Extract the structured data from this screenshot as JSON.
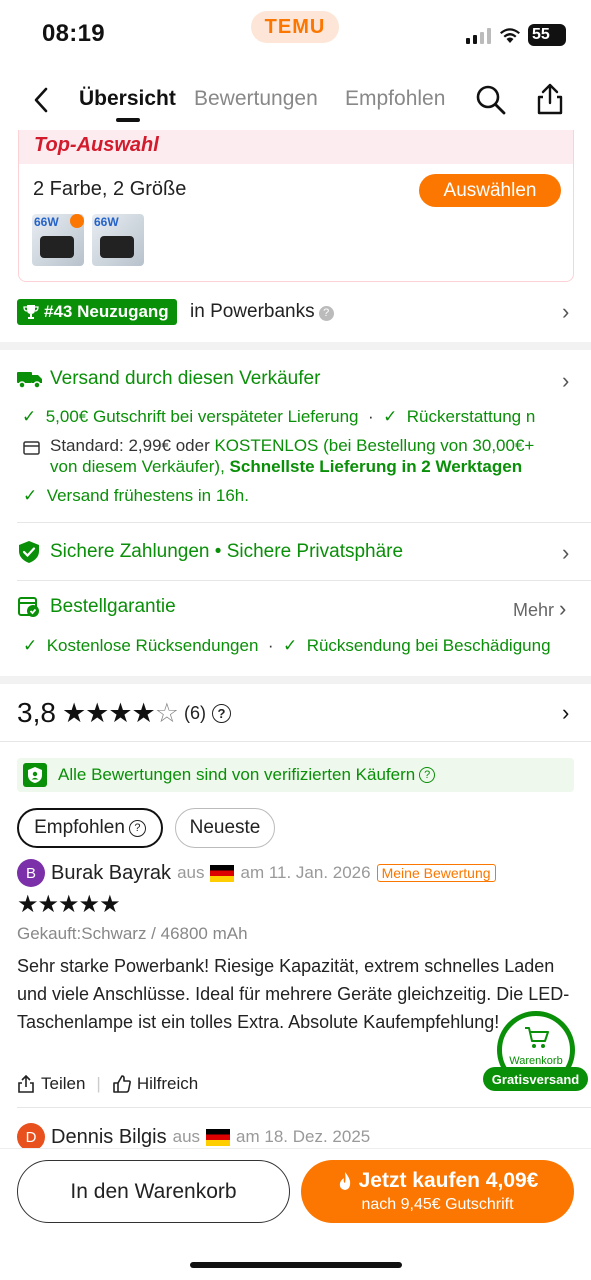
{
  "status_bar": {
    "time": "08:19",
    "brand": "TEMU",
    "battery": "55"
  },
  "nav": {
    "tabs": [
      "Übersicht",
      "Bewertungen",
      "Empfohlen"
    ]
  },
  "top_selection": {
    "header": "Top-Auswahl",
    "variants": "2 Farbe, 2 Größe",
    "select_button": "Auswählen",
    "thumbs": [
      {
        "label": "66W"
      },
      {
        "label": "66W"
      }
    ]
  },
  "ranking": {
    "badge": "#43 Neuzugang",
    "category": "in Powerbanks"
  },
  "shipping": {
    "title": "Versand durch diesen Verkäufer",
    "guarantee_1": "5,00€ Gutschrift bei verspäteter Lieferung",
    "guarantee_2": "Rückerstattung n",
    "standard_label": "Standard: 2,99€ oder",
    "standard_free": "KOSTENLOS (bei Bestellung von 30,00€+",
    "standard_line2": "von diesem Verkäufer),",
    "fastest": "Schnellste Lieferung in 2 Werktagen",
    "earliest": "Versand frühestens in 16h."
  },
  "payments": {
    "secure_pay": "Sichere Zahlungen",
    "privacy": "Sichere Privatsphäre"
  },
  "order_guarantee": {
    "title": "Bestellgarantie",
    "more": "Mehr",
    "item_1": "Kostenlose Rücksendungen",
    "item_2": "Rücksendung bei Beschädigung"
  },
  "rating": {
    "score": "3,8",
    "stars": 3.8,
    "count": "(6)"
  },
  "verified_note": "Alle Bewertungen sind von verifizierten Käufern",
  "sort_chips": {
    "recommended": "Empfohlen",
    "newest": "Neueste"
  },
  "reviews": [
    {
      "initial": "B",
      "avatar_color": "#7b2fa8",
      "name": "Burak Bayrak",
      "from": "aus",
      "date": "am 11. Jan. 2026",
      "badge": "Meine Bewertung",
      "rating": 5,
      "purchased": "Gekauft:Schwarz / 46800 mAh",
      "text": "Sehr starke Powerbank! Riesige Kapazität, extrem schnelles Laden und viele Anschlüsse. Ideal für mehrere Geräte gleichzeitig. Die LED-Taschenlampe ist ein tolles Extra. Absolute Kaufempfehlung!",
      "share": "Teilen",
      "helpful": "Hilfreich"
    },
    {
      "initial": "D",
      "avatar_color": "#e8501e",
      "name": "Dennis Bilgis",
      "from": "aus",
      "date": "am 18. Dez. 2025"
    }
  ],
  "floating_cart": {
    "label": "Warenkorb",
    "free_shipping": "Gratisversand"
  },
  "bottom": {
    "add_to_cart": "In den Warenkorb",
    "buy_now": "Jetzt kaufen 4,09€",
    "buy_sub": "nach 9,45€ Gutschrift"
  },
  "colors": {
    "brand_orange": "#fb7701",
    "trust_green": "#0a8f08",
    "top_red": "#d21c2e"
  }
}
